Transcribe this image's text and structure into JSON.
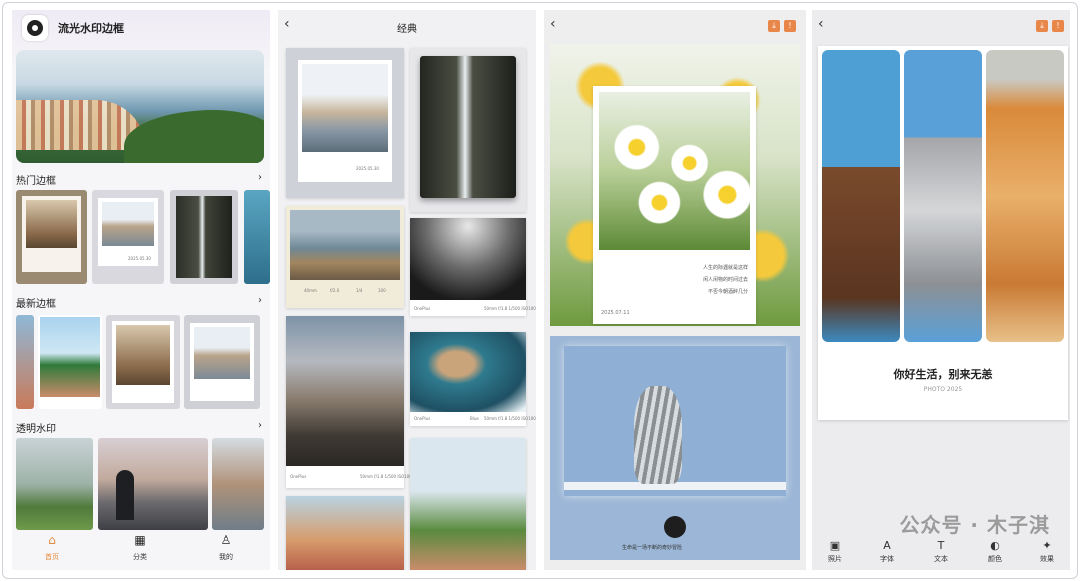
{
  "home": {
    "app_title": "流光水印边框",
    "sections": [
      {
        "title": "热门边框",
        "more": "›"
      },
      {
        "title": "最新边框",
        "more": "›"
      },
      {
        "title": "透明水印",
        "more": "›"
      }
    ],
    "thumb_captions": {
      "date": "2025.05.30"
    },
    "tabs": [
      {
        "label": "首页",
        "icon": "home-icon",
        "glyph": "⌂"
      },
      {
        "label": "分类",
        "icon": "grid-icon",
        "glyph": "▦"
      },
      {
        "label": "我的",
        "icon": "user-icon",
        "glyph": "♙"
      }
    ]
  },
  "classic": {
    "back": "‹",
    "title": "经典",
    "polaroid_date": "2025.05.30",
    "exif_values": [
      "40mm",
      "f/2.0",
      "1/4",
      "100"
    ],
    "captions": [
      {
        "brand": "OnePlus",
        "meta": "50mm f/1.8 1/500 ISO100"
      },
      {
        "brand": "OnePlus",
        "meta": "50mm f/1.8 1/500 ISO100"
      },
      {
        "brand": "OnePlus",
        "meta": "50mm f/1.8 1/500 ISO100"
      }
    ],
    "sign_text": "Blue"
  },
  "editor1": {
    "back": "‹",
    "poem": [
      "人生的际遇就是这样",
      "闲人闲物的时间过去",
      "不否今朝酒醉几分"
    ],
    "date": "2025.07.11",
    "bottom_text": "生命是一场不断的奇妙冒险"
  },
  "editor2": {
    "back": "‹",
    "headline": "你好生活，别来无恙",
    "subline": "PHOTO 2025",
    "watermark": "公众号 · 木子淇",
    "tools": [
      {
        "label": "照片",
        "icon": "photo-icon",
        "glyph": "▣"
      },
      {
        "label": "字体",
        "icon": "font-icon",
        "glyph": "A"
      },
      {
        "label": "文本",
        "icon": "text-icon",
        "glyph": "T"
      },
      {
        "label": "颜色",
        "icon": "palette-icon",
        "glyph": "◐"
      },
      {
        "label": "效果",
        "icon": "effect-icon",
        "glyph": "✦"
      }
    ]
  },
  "colors": {
    "accent": "#e58a3a",
    "action_button": "#e9874a"
  }
}
